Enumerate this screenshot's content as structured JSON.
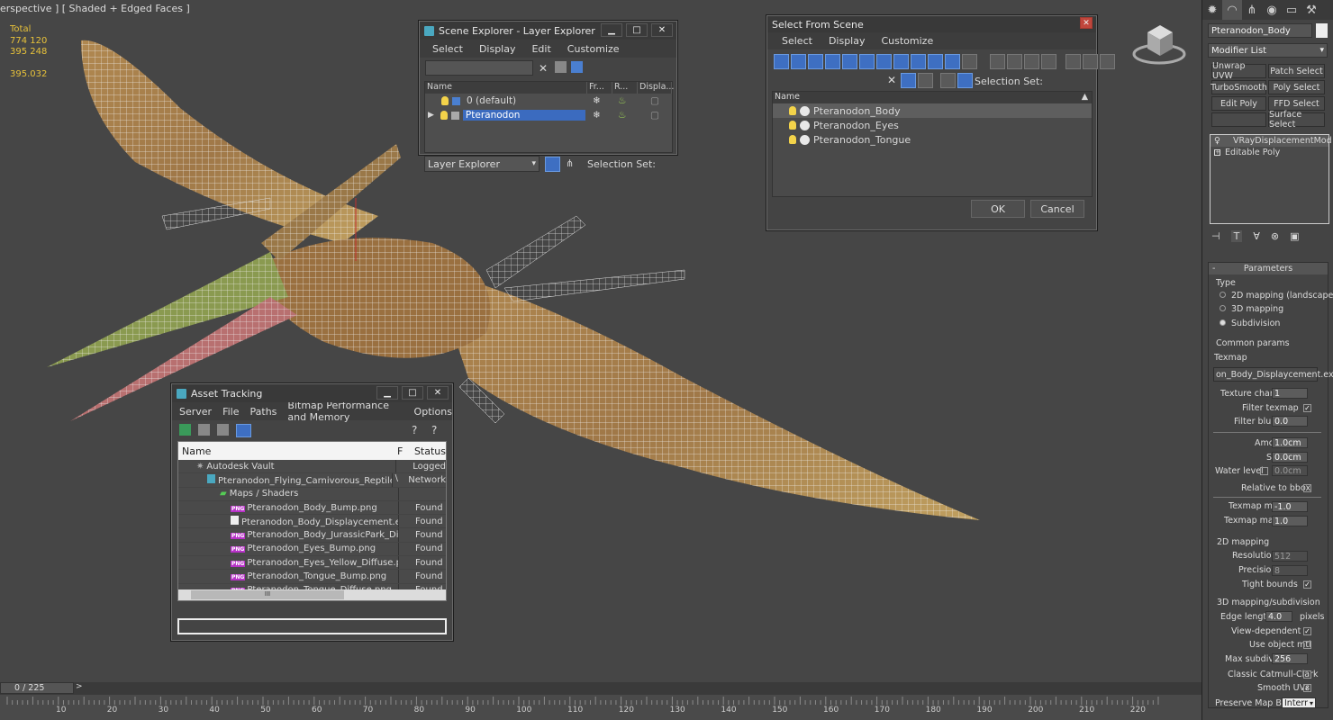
{
  "viewport": {
    "label": "erspective ] [ Shaded + Edged Faces ]",
    "stats": [
      "Total",
      "774 120",
      "395 248",
      "",
      "395.032"
    ]
  },
  "scene_explorer": {
    "title": "Scene Explorer - Layer Explorer",
    "menu": [
      "Select",
      "Display",
      "Edit",
      "Customize"
    ],
    "columns": [
      "Name",
      "Fr...",
      "R...",
      "Displa..."
    ],
    "rows": [
      {
        "name": "0 (default)",
        "selected": false
      },
      {
        "name": "Pteranodon",
        "selected": true
      }
    ],
    "explorer_combo": "Layer Explorer",
    "selection_set_label": "Selection Set:"
  },
  "select_from_scene": {
    "title": "Select From Scene",
    "menu": [
      "Select",
      "Display",
      "Customize"
    ],
    "selection_set_label": "Selection Set:",
    "column": "Name",
    "items": [
      "Pteranodon_Body",
      "Pteranodon_Eyes",
      "Pteranodon_Tongue"
    ],
    "ok": "OK",
    "cancel": "Cancel"
  },
  "asset_tracking": {
    "title": "Asset Tracking",
    "menu": [
      "Server",
      "File",
      "Paths",
      "Bitmap Performance and Memory",
      "Options"
    ],
    "columns": [
      "Name",
      "F",
      "Status"
    ],
    "rows": [
      {
        "name": "Autodesk Vault",
        "f": "",
        "status": "Logged",
        "indent": 0
      },
      {
        "name": "Pteranodon_Flying_Carnivorous_Reptile_vra...",
        "f": "\\",
        "status": "Network",
        "indent": 1
      },
      {
        "name": "Maps / Shaders",
        "f": "",
        "status": "",
        "indent": 2
      },
      {
        "name": "Pteranodon_Body_Bump.png",
        "f": "",
        "status": "Found",
        "indent": 3
      },
      {
        "name": "Pteranodon_Body_Displaycement.exr",
        "f": "",
        "status": "Found",
        "indent": 3
      },
      {
        "name": "Pteranodon_Body_JurassicPark_Diffus...",
        "f": "",
        "status": "Found",
        "indent": 3
      },
      {
        "name": "Pteranodon_Eyes_Bump.png",
        "f": "",
        "status": "Found",
        "indent": 3
      },
      {
        "name": "Pteranodon_Eyes_Yellow_Diffuse.png",
        "f": "",
        "status": "Found",
        "indent": 3
      },
      {
        "name": "Pteranodon_Tongue_Bump.png",
        "f": "",
        "status": "Found",
        "indent": 3
      },
      {
        "name": "Pteranodon_Tongue_Diffuse.png",
        "f": "",
        "status": "Found",
        "indent": 3
      }
    ],
    "scroll_label": "III"
  },
  "command_panel": {
    "object_name": "Pteranodon_Body",
    "modifier_list": "Modifier List",
    "buttons": [
      "Unwrap UVW",
      "Patch Select",
      "TurboSmooth",
      "Poly Select",
      "Edit Poly",
      "FFD Select",
      "",
      "Surface Select"
    ],
    "stack": [
      "VRayDisplacementMod",
      "Editable Poly"
    ],
    "parameters_title": "Parameters",
    "type_label": "Type",
    "type_options": [
      "2D mapping (landscape)",
      "3D mapping",
      "Subdivision"
    ],
    "common_params": "Common params",
    "texmap_label": "Texmap",
    "texmap_value": "on_Body_Displaycement.exr)",
    "texture_chan_label": "Texture chan",
    "texture_chan": "1",
    "filter_texmap_label": "Filter texmap",
    "filter_blur_label": "Filter blur",
    "filter_blur": "0.0",
    "amount_label": "Amount",
    "amount": "1.0cm",
    "shift_label": "Shift",
    "shift": "0.0cm",
    "water_level_label": "Water level",
    "water_level": "0.0cm",
    "relative_bbox_label": "Relative to bbox",
    "texmap_min_label": "Texmap min",
    "texmap_min": "-1.0",
    "texmap_max_label": "Texmap max",
    "texmap_max": "1.0",
    "mapping2d_label": "2D mapping",
    "resolution_label": "Resolution",
    "resolution": "512",
    "precision_label": "Precision",
    "precision": "8",
    "tight_bounds_label": "Tight bounds",
    "mapping3d_label": "3D mapping/subdivision",
    "edge_length_label": "Edge length",
    "edge_length": "4.0",
    "pixels_label": "pixels",
    "view_dependent_label": "View-dependent",
    "use_object_mtl_label": "Use object mtl",
    "max_subdivs_label": "Max subdivs",
    "max_subdivs": "256",
    "catmull_label": "Classic Catmull-Clark",
    "smooth_uvs_label": "Smooth UVs",
    "preserve_label": "Preserve Map Bnd",
    "preserve_value": "Interr"
  },
  "timeline": {
    "frame": "0 / 225",
    "next": ">",
    "ticks": [
      "10",
      "20",
      "30",
      "40",
      "50",
      "60",
      "70",
      "80",
      "90",
      "100",
      "110",
      "120",
      "130",
      "140",
      "150",
      "160",
      "170",
      "180",
      "190",
      "200",
      "210",
      "220"
    ]
  }
}
